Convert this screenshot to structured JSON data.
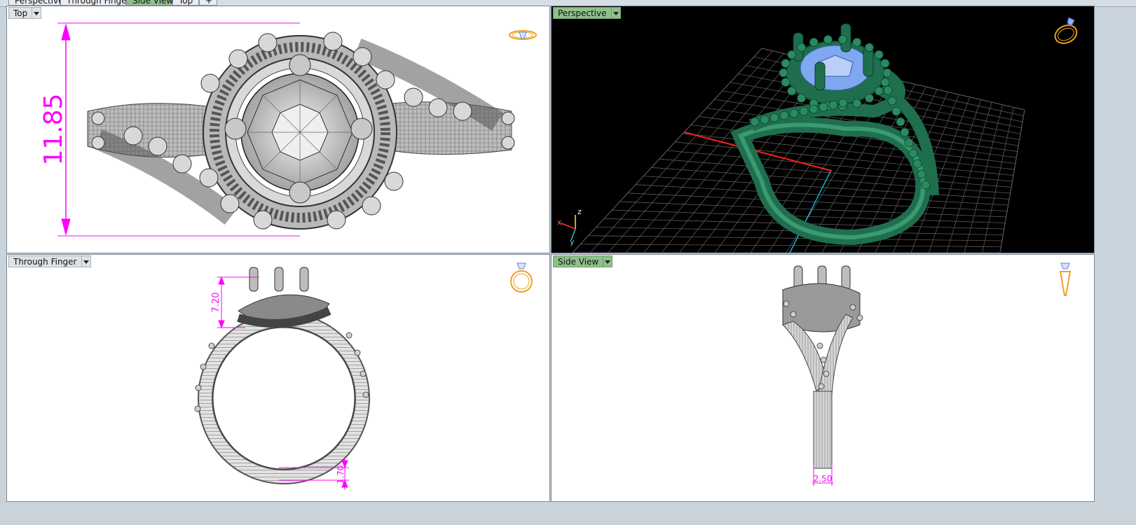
{
  "tabs": [
    {
      "label": "Perspective",
      "active": false
    },
    {
      "label": "Through Finger",
      "active": false
    },
    {
      "label": "Side View",
      "active": true
    },
    {
      "label": "Top",
      "active": false
    },
    {
      "label": "+",
      "active": false
    }
  ],
  "viewports": {
    "top": {
      "title": "Top",
      "active": false,
      "dimension": "11.85"
    },
    "perspective": {
      "title": "Perspective",
      "active": true,
      "axes": {
        "x": "x",
        "y": "y",
        "z": "z"
      }
    },
    "through_finger": {
      "title": "Through Finger",
      "active": false,
      "dimension_height": "7.20",
      "dimension_thickness": "1.70"
    },
    "side_view": {
      "title": "Side View",
      "active": true,
      "dimension_width": "2.50"
    }
  },
  "colors": {
    "dimension": "#ff00ff",
    "active_title": "#8fc08b",
    "ring_green": "#1f6f4f",
    "gem_blue": "#7fa8f0",
    "nav_icon": "#f0a020",
    "axis_x": "#ff2020",
    "axis_y": "#20b0d0"
  },
  "icons": [
    "ring-top-icon",
    "ring-perspective-icon",
    "ring-front-icon",
    "ring-side-icon",
    "dropdown-arrow-icon"
  ]
}
